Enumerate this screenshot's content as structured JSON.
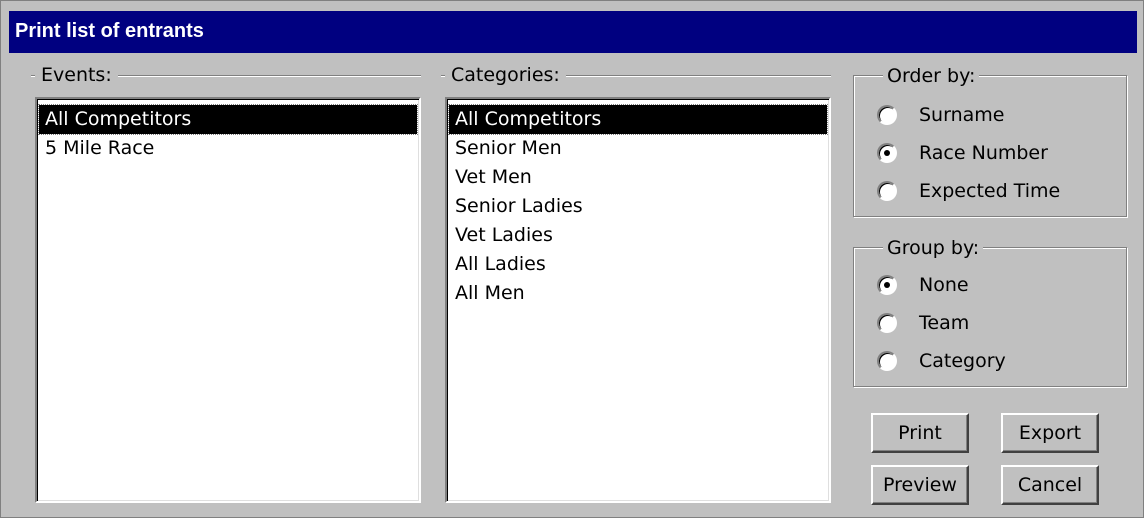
{
  "window": {
    "title": "Print list of entrants"
  },
  "events": {
    "label": "Events:",
    "items": [
      "All Competitors",
      "5 Mile Race"
    ],
    "selected": "All Competitors"
  },
  "categories": {
    "label": "Categories:",
    "items": [
      "All Competitors",
      "Senior Men",
      "Vet Men",
      "Senior Ladies",
      "Vet Ladies",
      "All Ladies",
      "All Men"
    ],
    "selected": "All Competitors"
  },
  "order_by": {
    "label": "Order by:",
    "options": [
      "Surname",
      "Race Number",
      "Expected Time"
    ],
    "selected": "Race Number"
  },
  "group_by": {
    "label": "Group by:",
    "options": [
      "None",
      "Team",
      "Category"
    ],
    "selected": "None"
  },
  "buttons": {
    "print": "Print",
    "export": "Export",
    "preview": "Preview",
    "cancel": "Cancel"
  }
}
